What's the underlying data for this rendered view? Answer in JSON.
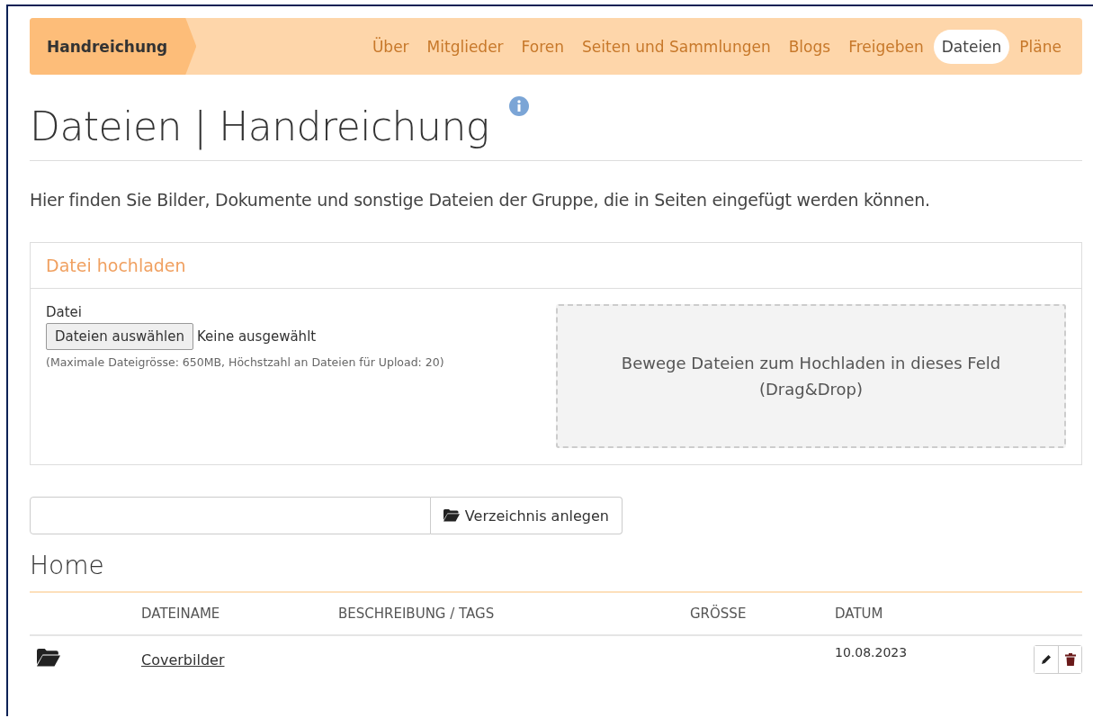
{
  "breadcrumb": "Handreichung",
  "tabs": [
    {
      "label": "Über",
      "selected": false
    },
    {
      "label": "Mitglieder",
      "selected": false
    },
    {
      "label": "Foren",
      "selected": false
    },
    {
      "label": "Seiten und Sammlungen",
      "selected": false
    },
    {
      "label": "Blogs",
      "selected": false
    },
    {
      "label": "Freigeben",
      "selected": false
    },
    {
      "label": "Dateien",
      "selected": true
    },
    {
      "label": "Pläne",
      "selected": false
    }
  ],
  "page_title": "Dateien | Handreichung",
  "description": "Hier finden Sie Bilder, Dokumente und sonstige Dateien der Gruppe, die in Seiten eingefügt werden können.",
  "upload": {
    "title": "Datei hochladen",
    "field_label": "Datei",
    "choose_button": "Dateien auswählen",
    "chosen": "Keine ausgewählt",
    "hint": "(Maximale Dateigrösse: 650MB, Höchstzahl an Dateien für Upload: 20)",
    "dropzone": [
      "Bewege Dateien zum Hochladen in dieses Feld",
      "(Drag&Drop)"
    ]
  },
  "folder_create": {
    "button": "Verzeichnis anlegen"
  },
  "folder_title": "Home",
  "table": {
    "columns": [
      "DATEINAME",
      "BESCHREIBUNG / TAGS",
      "GRÖSSE",
      "DATUM"
    ],
    "rows": [
      {
        "kind": "folder",
        "name": "Coverbilder",
        "date": "10.08.2023"
      }
    ]
  }
}
